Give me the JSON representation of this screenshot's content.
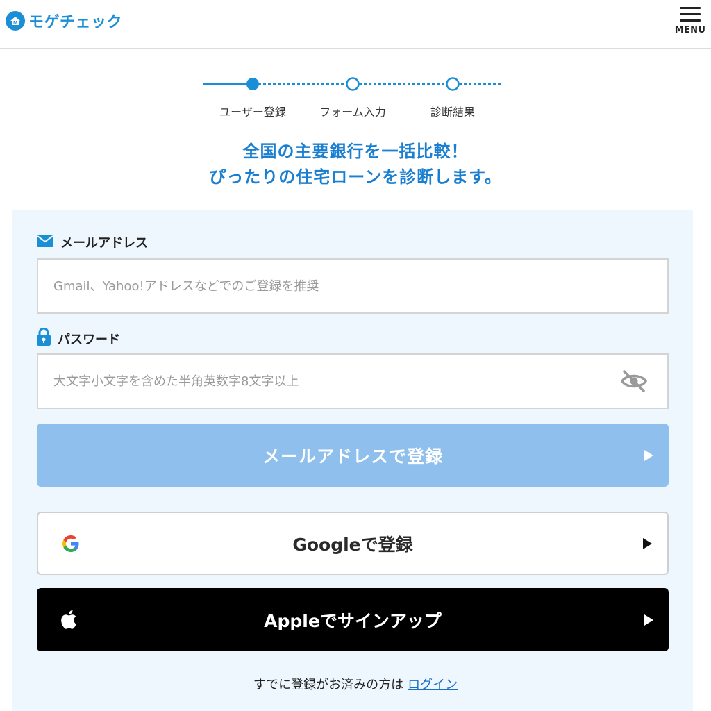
{
  "header": {
    "logo_text": "モゲチェック",
    "menu_label": "MENU"
  },
  "stepper": {
    "steps": [
      {
        "label": "ユーザー登録",
        "state": "current"
      },
      {
        "label": "フォーム入力",
        "state": "upcoming"
      },
      {
        "label": "診断結果",
        "state": "upcoming"
      }
    ]
  },
  "headline": {
    "line1": "全国の主要銀行を一括比較！",
    "line2": "ぴったりの住宅ローンを診断します。"
  },
  "form": {
    "email_label": "メールアドレス",
    "email_placeholder": "Gmail、Yahoo!アドレスなどでのご登録を推奨",
    "email_value": "",
    "password_label": "パスワード",
    "password_placeholder": "大文字小文字を含めた半角英数字8文字以上",
    "password_value": "",
    "email_submit_label": "メールアドレスで登録",
    "google_label": "Googleで登録",
    "apple_label": "Appleでサインアップ",
    "login_prompt": "すでに登録がお済みの方は",
    "login_link": "ログイン"
  },
  "colors": {
    "brand": "#1a8fd6",
    "headline": "#1a7fd0",
    "panel_bg": "#eef7fe",
    "email_button_disabled": "#8fbfec",
    "apple_button": "#000000",
    "link": "#1a6fc4"
  },
  "icons": {
    "email": "envelope-icon",
    "password": "lock-icon",
    "toggle_password": "eye-slash-icon",
    "google": "google-g-icon",
    "apple": "apple-icon"
  }
}
